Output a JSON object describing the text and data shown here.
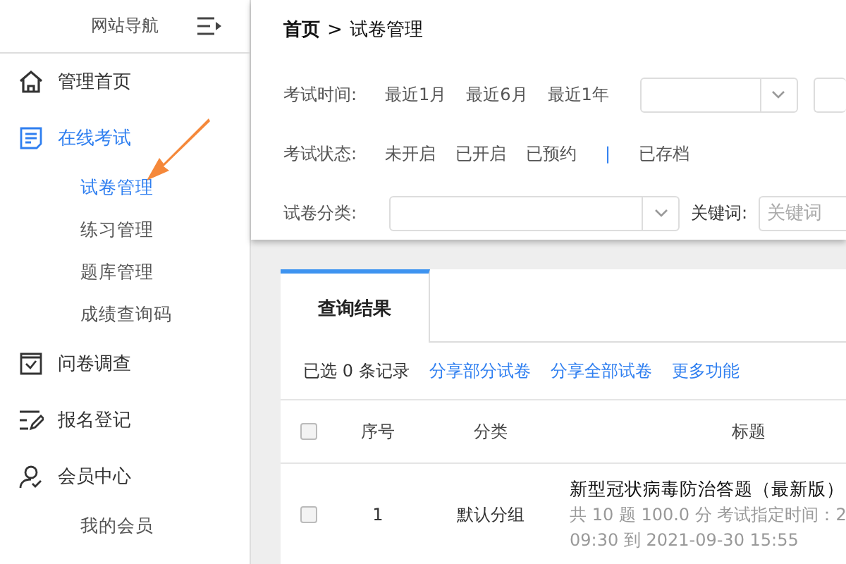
{
  "sidebar": {
    "title": "网站导航",
    "items": [
      {
        "label": "管理首页",
        "selected": false
      },
      {
        "label": "在线考试",
        "selected": true,
        "children": [
          {
            "label": "试卷管理",
            "selected": true
          },
          {
            "label": "练习管理",
            "selected": false
          },
          {
            "label": "题库管理",
            "selected": false
          },
          {
            "label": "成绩查询码",
            "selected": false
          }
        ]
      },
      {
        "label": "问卷调查",
        "selected": false
      },
      {
        "label": "报名登记",
        "selected": false
      },
      {
        "label": "会员中心",
        "selected": false,
        "children": [
          {
            "label": "我的会员",
            "selected": false
          }
        ]
      }
    ]
  },
  "breadcrumb": {
    "home": "首页",
    "separator": ">",
    "current": "试卷管理"
  },
  "filters": {
    "time": {
      "label": "考试时间:",
      "options": [
        "最近1月",
        "最近6月",
        "最近1年"
      ]
    },
    "status": {
      "label": "考试状态:",
      "options": [
        {
          "kind": "option",
          "text": "未开启"
        },
        {
          "kind": "option",
          "text": "已开启"
        },
        {
          "kind": "option",
          "text": "已预约"
        },
        {
          "kind": "divider",
          "text": "|"
        },
        {
          "kind": "option",
          "text": "已存档"
        }
      ]
    },
    "category": {
      "label": "试卷分类:"
    },
    "keyword": {
      "label": "关键词:",
      "placeholder": "关键词"
    }
  },
  "results": {
    "tab": "查询结果",
    "selected_count": "已选 0 条记录",
    "actions": [
      "分享部分试卷",
      "分享全部试卷",
      "更多功能"
    ],
    "select_all": {
      "checked": false
    },
    "columns": [
      "序号",
      "分类",
      "标题"
    ],
    "rows": [
      {
        "checked": false,
        "number": "1",
        "category": "默认分组",
        "title": "新型冠状病毒防治答题（最新版）",
        "meta": "共 10 题 100.0 分  考试指定时间：2",
        "meta2": "09:30 到 2021-09-30 15:55"
      }
    ]
  }
}
